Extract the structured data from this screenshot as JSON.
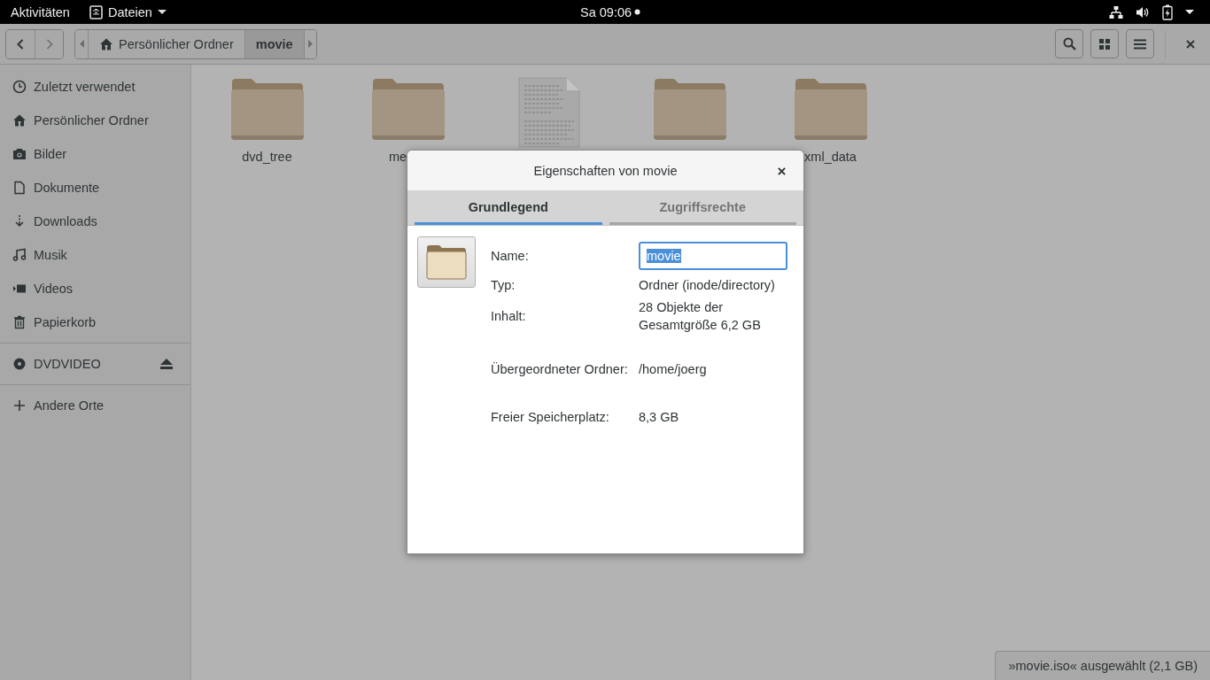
{
  "top_bar": {
    "activities": "Aktivitäten",
    "app_menu": "Dateien",
    "clock": "Sa 09:06"
  },
  "header": {
    "path": [
      {
        "label": "Persönlicher Ordner",
        "kind": "home",
        "selected": false
      },
      {
        "label": "movie",
        "kind": "folder",
        "selected": true
      }
    ]
  },
  "sidebar": {
    "groups": [
      [
        {
          "label": "Zuletzt verwendet",
          "kind": "recent"
        },
        {
          "label": "Persönlicher Ordner",
          "kind": "home"
        },
        {
          "label": "Bilder",
          "kind": "camera"
        },
        {
          "label": "Dokumente",
          "kind": "document"
        },
        {
          "label": "Downloads",
          "kind": "download"
        },
        {
          "label": "Musik",
          "kind": "music"
        },
        {
          "label": "Videos",
          "kind": "video"
        },
        {
          "label": "Papierkorb",
          "kind": "trash"
        }
      ],
      [
        {
          "label": "DVDVIDEO",
          "kind": "disc",
          "eject": true
        }
      ],
      [
        {
          "label": "Andere Orte",
          "kind": "plus"
        }
      ]
    ]
  },
  "files": [
    {
      "kind": "folder",
      "label": "dvd_tree"
    },
    {
      "kind": "folder",
      "label": "me",
      "cut": true
    },
    {
      "kind": "document"
    },
    {
      "kind": "folder"
    },
    {
      "kind": "folder",
      "label": "xml_data"
    }
  ],
  "dialog": {
    "title": "Eigenschaften von movie",
    "tabs": [
      {
        "label": "Grundlegend",
        "selected": true
      },
      {
        "label": "Zugriffsrechte",
        "selected": false
      }
    ],
    "name_label": "Name:",
    "name_value": "movie",
    "properties": [
      {
        "label": "Typ:",
        "value": [
          "Ordner (inode/directory)"
        ]
      },
      {
        "label": "Inhalt:",
        "value": [
          "28 Objekte der",
          "Gesamtgröße 6,2 GB"
        ]
      },
      {
        "label": "Übergeordneter Ordner:",
        "value": [
          "/home/joerg"
        ]
      },
      {
        "label": "Freier Speicherplatz:",
        "value": [
          "8,3 GB"
        ]
      }
    ]
  },
  "status": "»movie.iso« ausgewählt  (2,1 GB)"
}
